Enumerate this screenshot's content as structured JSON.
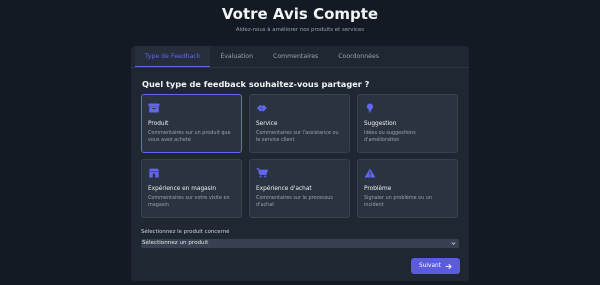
{
  "header": {
    "title": "Votre Avis Compte",
    "subtitle": "Aidez-nous à améliorer nos produits et services"
  },
  "tabs": [
    {
      "label": "Type de Feedback",
      "active": true
    },
    {
      "label": "Évaluation",
      "active": false
    },
    {
      "label": "Commentaires",
      "active": false
    },
    {
      "label": "Coordonnées",
      "active": false
    }
  ],
  "question": "Quel type de feedback souhaitez-vous partager ?",
  "options": [
    {
      "icon": "box-icon",
      "name": "Produit",
      "desc": "Commentaires sur un produit que vous avez acheté",
      "selected": true
    },
    {
      "icon": "handshake-icon",
      "name": "Service",
      "desc": "Commentaires sur l'assistance ou le service client",
      "selected": false
    },
    {
      "icon": "lightbulb-icon",
      "name": "Suggestion",
      "desc": "Idées ou suggestions d'amélioration",
      "selected": false
    },
    {
      "icon": "store-icon",
      "name": "Expérience en magasin",
      "desc": "Commentaires sur votre visite en magasin",
      "selected": false
    },
    {
      "icon": "cart-icon",
      "name": "Expérience d'achat",
      "desc": "Commentaires sur le processus d'achat",
      "selected": false
    },
    {
      "icon": "warning-icon",
      "name": "Problème",
      "desc": "Signaler un problème ou un incident",
      "selected": false
    }
  ],
  "product_select": {
    "label": "Sélectionnez le produit concerné",
    "value": "Sélectionnez un produit"
  },
  "next_button": {
    "label": "Suivant",
    "icon": "arrow-right-icon"
  },
  "colors": {
    "background": "#141a24",
    "panel": "#1f2732",
    "card": "#2a3340",
    "accent": "#6366f1",
    "button": "#5b5be0"
  }
}
